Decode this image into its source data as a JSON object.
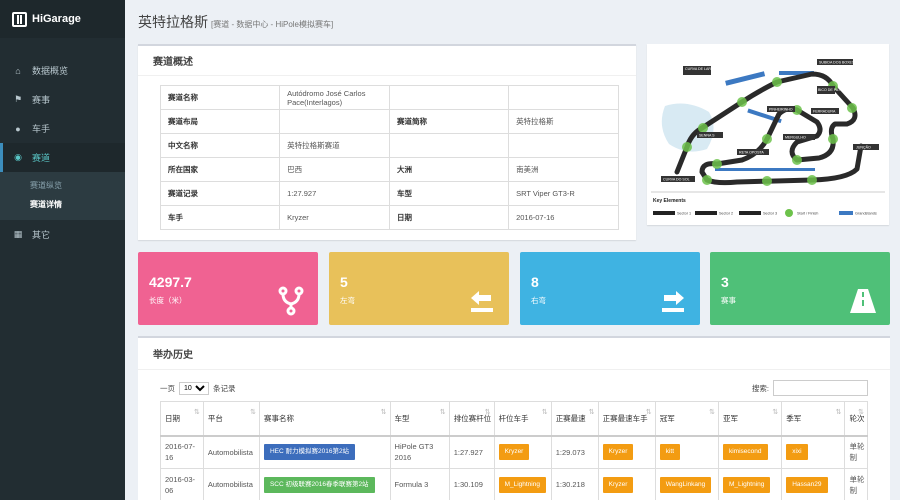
{
  "brand": {
    "name": "HiGarage"
  },
  "sidebar": {
    "items": [
      {
        "label": "数据概览",
        "icon": "home-icon"
      },
      {
        "label": "赛事",
        "icon": "flag-icon"
      },
      {
        "label": "车手",
        "icon": "user-icon"
      },
      {
        "label": "赛道",
        "icon": "map-marker-icon"
      },
      {
        "label": "其它",
        "icon": "grid-icon"
      }
    ],
    "submenu": [
      "赛道纵览",
      "赛道详情"
    ]
  },
  "header": {
    "title": "英特拉格斯",
    "subtitle": "[赛道 - 数据中心 - HiPole模拟赛车]"
  },
  "overview": {
    "title": "赛道概述",
    "rows": [
      {
        "k1": "赛道名称",
        "v1": "Autódromo José Carlos Pace(Interlagos)",
        "k2": "",
        "v2": ""
      },
      {
        "k1": "赛道布局",
        "v1": "",
        "k2": "赛道简称",
        "v2": "英特拉格斯"
      },
      {
        "k1": "中文名称",
        "v1": "英特拉格斯赛道",
        "k2": "",
        "v2": ""
      },
      {
        "k1": "所在国家",
        "v1": "巴西",
        "k2": "大洲",
        "v2": "南美洲"
      },
      {
        "k1": "赛道记录",
        "v1": "1:27.927",
        "k2": "车型",
        "v2": "SRT Viper GT3-R"
      },
      {
        "k1": "车手",
        "v1": "Kryzer",
        "k2": "日期",
        "v2": "2016-07-16"
      }
    ]
  },
  "map": {
    "labels": [
      "CURVA DE LARANJINHA",
      "SUBIDA DOS BOXES",
      "BICO DE PATO",
      "PINHEIRINHO",
      "FERRADURA",
      "JUNÇÃO",
      "MERGULHO",
      "RETA OPOSTA",
      "SENNA S",
      "CURVA DO SOL",
      "DESCIDA DO LAGO"
    ],
    "legend_title": "Key Elements",
    "legend": [
      "Sector 1",
      "Sector 2",
      "Sector 3",
      "Start / Finish",
      "Grandstands"
    ]
  },
  "tiles": [
    {
      "value": "4297.7",
      "label": "长度（米）",
      "color": "#f06292",
      "icon": "fork-icon"
    },
    {
      "value": "5",
      "label": "左弯",
      "color": "#e8c15a",
      "icon": "left-arrow-icon"
    },
    {
      "value": "8",
      "label": "右弯",
      "color": "#3fb3e2",
      "icon": "right-arrow-icon"
    },
    {
      "value": "3",
      "label": "赛事",
      "color": "#4fc078",
      "icon": "road-icon"
    }
  ],
  "history": {
    "title": "举办历史",
    "show_prefix": "一页",
    "page_size": "10",
    "show_suffix": "条记录",
    "search_label": "搜索:",
    "columns": [
      "日期",
      "平台",
      "赛事名称",
      "车型",
      "排位赛杆位",
      "杆位车手",
      "正赛最速",
      "正赛最速车手",
      "冠军",
      "亚军",
      "季军",
      "轮次"
    ],
    "rows": [
      {
        "date": "2016-07-16",
        "platform": "Automobilista",
        "event": "HEC 耐力模拟赛2016第2站",
        "event_color": "blue",
        "car": "HiPole GT3 2016",
        "pole": "1:27.927",
        "pole_driver": "Kryzer",
        "fastest": "1:29.073",
        "fastest_driver": "Kryzer",
        "p1": "kitt",
        "p2": "kimisecond",
        "p3": "xixi",
        "round": "单轮制"
      },
      {
        "date": "2016-03-06",
        "platform": "Automobilista",
        "event": "SCC 初级联赛2016春季联赛第2站",
        "event_color": "green",
        "car": "Formula 3",
        "pole": "1:30.109",
        "pole_driver": "M_Lightning",
        "fastest": "1:30.218",
        "fastest_driver": "Kryzer",
        "p1": "WangLinkang",
        "p2": "M_Lightning",
        "p3": "Hassan29",
        "round": "单轮制"
      }
    ]
  }
}
